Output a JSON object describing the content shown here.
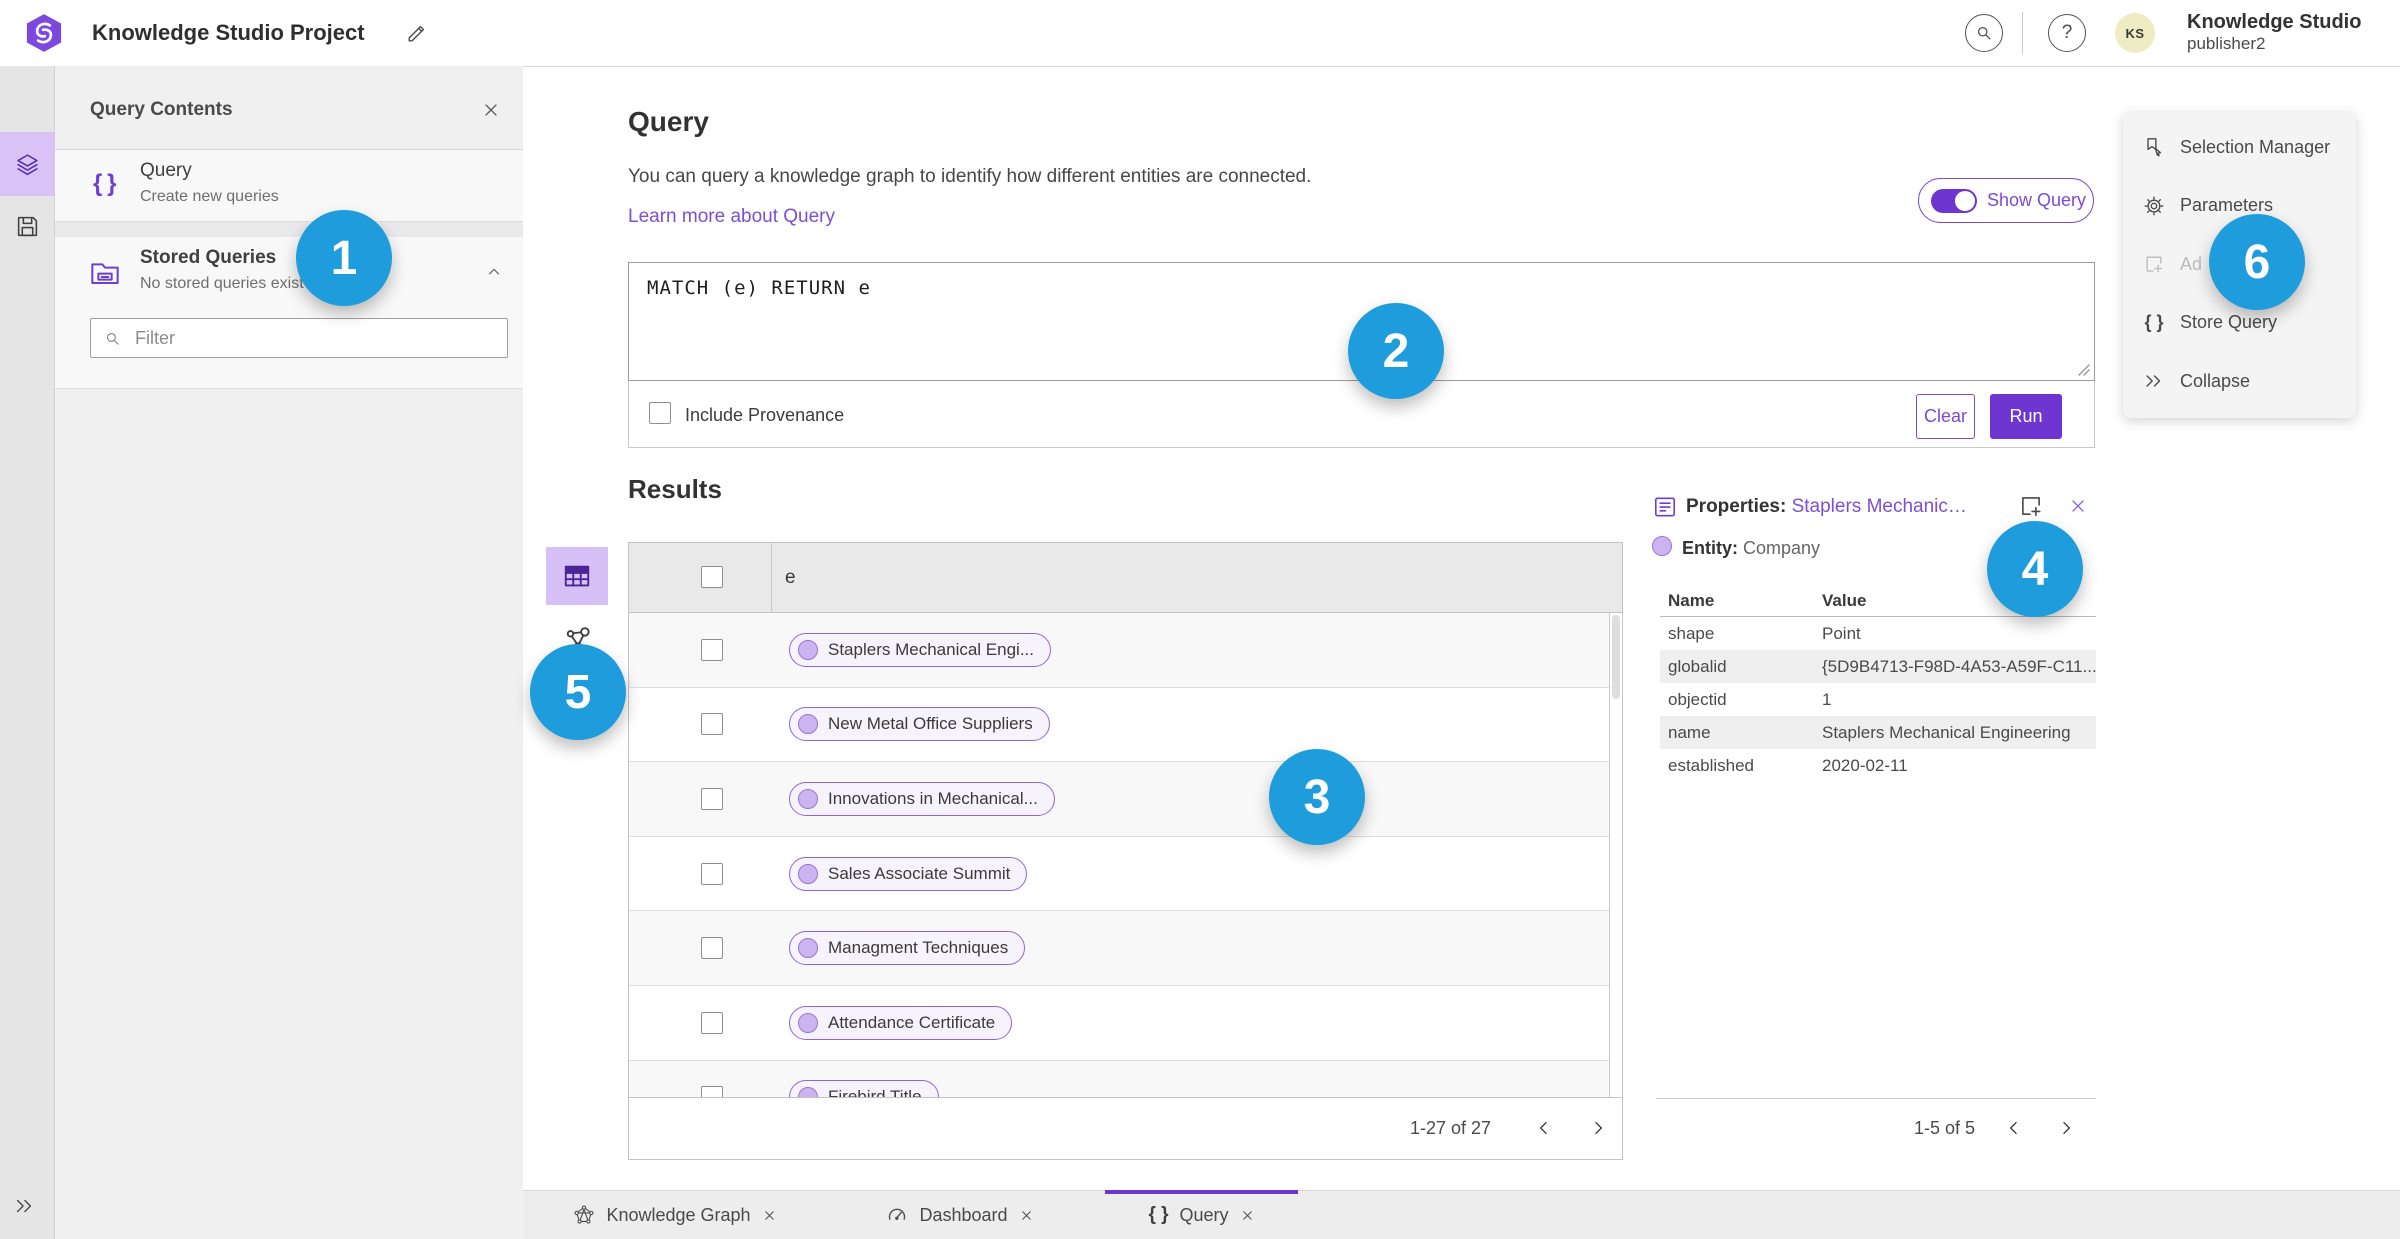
{
  "topbar": {
    "app_title": "Knowledge Studio Project",
    "help_label": "?",
    "avatar_initials": "KS",
    "user_name": "Knowledge Studio",
    "user_role": "publisher2"
  },
  "query_contents": {
    "title": "Query Contents",
    "items": [
      {
        "title": "Query",
        "subtitle": "Create new queries"
      },
      {
        "title": "Stored Queries",
        "subtitle": "No stored queries exist"
      }
    ],
    "filter_placeholder": "Filter"
  },
  "query": {
    "heading": "Query",
    "description": "You can query a knowledge graph to identify how different entities are connected.",
    "learn_more": "Learn more about Query",
    "show_query_label": "Show Query",
    "query_text": "MATCH (e) RETURN e",
    "include_provenance_label": "Include Provenance",
    "clear_label": "Clear",
    "run_label": "Run"
  },
  "results": {
    "heading": "Results",
    "column_header": "e",
    "rows": [
      "Staplers Mechanical Engi...",
      "New Metal Office Suppliers",
      "Innovations in Mechanical...",
      "Sales Associate Summit",
      "Managment Techniques",
      "Attendance Certificate",
      "Firebird Title"
    ],
    "pagination": "1-27 of 27"
  },
  "properties": {
    "title_label": "Properties:",
    "title_link": "Staplers Mechanic…",
    "entity_label": "Entity:",
    "entity_value": "Company",
    "columns": [
      "Name",
      "Value"
    ],
    "rows": [
      [
        "shape",
        "Point"
      ],
      [
        "globalid",
        "{5D9B4713-F98D-4A53-A59F-C11..."
      ],
      [
        "objectid",
        "1"
      ],
      [
        "name",
        "Staplers Mechanical Engineering"
      ],
      [
        "established",
        "2020-02-11"
      ]
    ],
    "pagination": "1-5 of 5"
  },
  "side_menu": {
    "items": [
      {
        "label": "Selection Manager",
        "icon": "selection-manager",
        "disabled": false
      },
      {
        "label": "Parameters",
        "icon": "gear",
        "disabled": false
      },
      {
        "label": "Ad",
        "icon": "add-square",
        "disabled": true
      },
      {
        "label": "Store Query",
        "icon": "braces",
        "disabled": false
      },
      {
        "label": "Collapse",
        "icon": "collapse",
        "disabled": false
      }
    ]
  },
  "tabs": [
    {
      "label": "Knowledge Graph",
      "icon": "kg-star",
      "active": false
    },
    {
      "label": "Dashboard",
      "icon": "gauge",
      "active": false
    },
    {
      "label": "Query",
      "icon": "braces",
      "active": true
    }
  ],
  "badges": [
    "1",
    "2",
    "3",
    "4",
    "5",
    "6"
  ],
  "icon_names": [
    "app-logo",
    "edit-pencil",
    "search",
    "help",
    "hierarchy",
    "layers",
    "save",
    "expand-chevrons",
    "braces",
    "stored-folder",
    "chevron-up",
    "filter-search",
    "toggle",
    "resize-handle",
    "table-view",
    "link-chart-view",
    "properties-doc",
    "add-square",
    "close-x",
    "selection-manager",
    "gear",
    "kg-star",
    "gauge",
    "chevron-left",
    "chevron-right"
  ],
  "colors": {
    "accent_purple": "#6f35d0",
    "link_purple": "#7b4fd6",
    "selected_lavender": "#d9c2f6",
    "badge_blue": "#1f9cdb",
    "pill_border": "#8d66d6",
    "avatar_bg": "#efecc3"
  }
}
